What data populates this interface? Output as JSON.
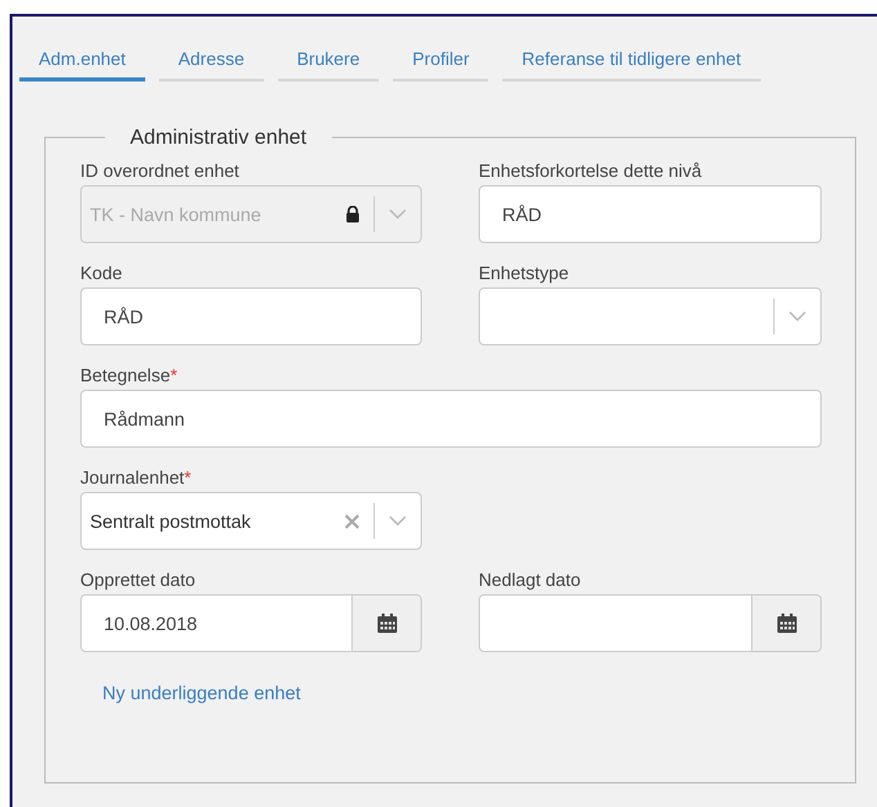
{
  "tabs": [
    {
      "label": "Adm.enhet",
      "selected": true
    },
    {
      "label": "Adresse",
      "selected": false
    },
    {
      "label": "Brukere",
      "selected": false
    },
    {
      "label": "Profiler",
      "selected": false
    },
    {
      "label": "Referanse til tidligere enhet",
      "selected": false
    }
  ],
  "section": {
    "legend": "Administrativ enhet",
    "rows": [
      [
        {
          "label": "ID overordnet enhet",
          "kind": "select",
          "value": "TK - Navn kommune",
          "disabled": true,
          "locked": true,
          "clearable": false
        },
        {
          "label": "Enhetsforkortelse dette nivå",
          "kind": "text",
          "value": "RÅD"
        }
      ],
      [
        {
          "label": "Kode",
          "kind": "text",
          "value": "RÅD"
        },
        {
          "label": "Enhetstype",
          "kind": "select",
          "disabled": false,
          "locked": false,
          "clearable": false
        }
      ],
      [
        {
          "label": "Betegnelse",
          "required_mark": "*",
          "kind": "text",
          "value": "Rådmann"
        }
      ],
      [
        {
          "label": "Journalenhet",
          "required_mark": "*",
          "kind": "select",
          "value": "Sentralt postmottak",
          "disabled": false,
          "locked": false,
          "clearable": true
        }
      ],
      [
        {
          "label": "Opprettet dato",
          "kind": "date",
          "value": "10.08.2018"
        },
        {
          "label": "Nedlagt dato",
          "kind": "date"
        }
      ]
    ],
    "link": "Ny underliggende enhet"
  }
}
